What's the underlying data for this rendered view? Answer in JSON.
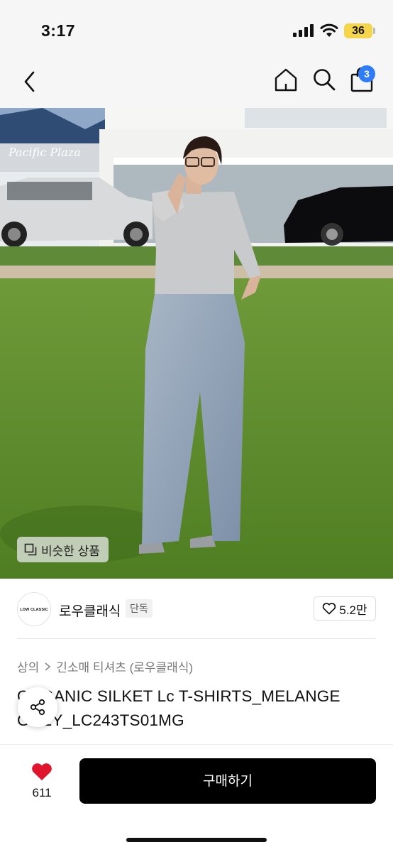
{
  "status_bar": {
    "time": "3:17",
    "battery": "36"
  },
  "nav": {
    "cart_count": "3",
    "icons": [
      "back-icon",
      "home-icon",
      "search-icon",
      "shopping-bag-icon"
    ]
  },
  "image": {
    "similar_label": "비슷한 상품",
    "sign_text": "Pacific Plaza"
  },
  "shop": {
    "logo_text": "LOW CLASSIC",
    "name": "로우클래식",
    "tag": "단독",
    "likes": "5.2만"
  },
  "breadcrumb": {
    "category": "상의",
    "subcategory": "긴소매 티셔츠 (로우클래식)"
  },
  "product": {
    "title": "ORGANIC SILKET Lc T-SHIRTS_MELANGE GREY_LC243TS01MG"
  },
  "bottom_bar": {
    "wish_count": "611",
    "buy_label": "구매하기"
  },
  "colors": {
    "accent_blue": "#2f7cf6",
    "wish_red": "#e0142a",
    "buy_black": "#000000"
  }
}
